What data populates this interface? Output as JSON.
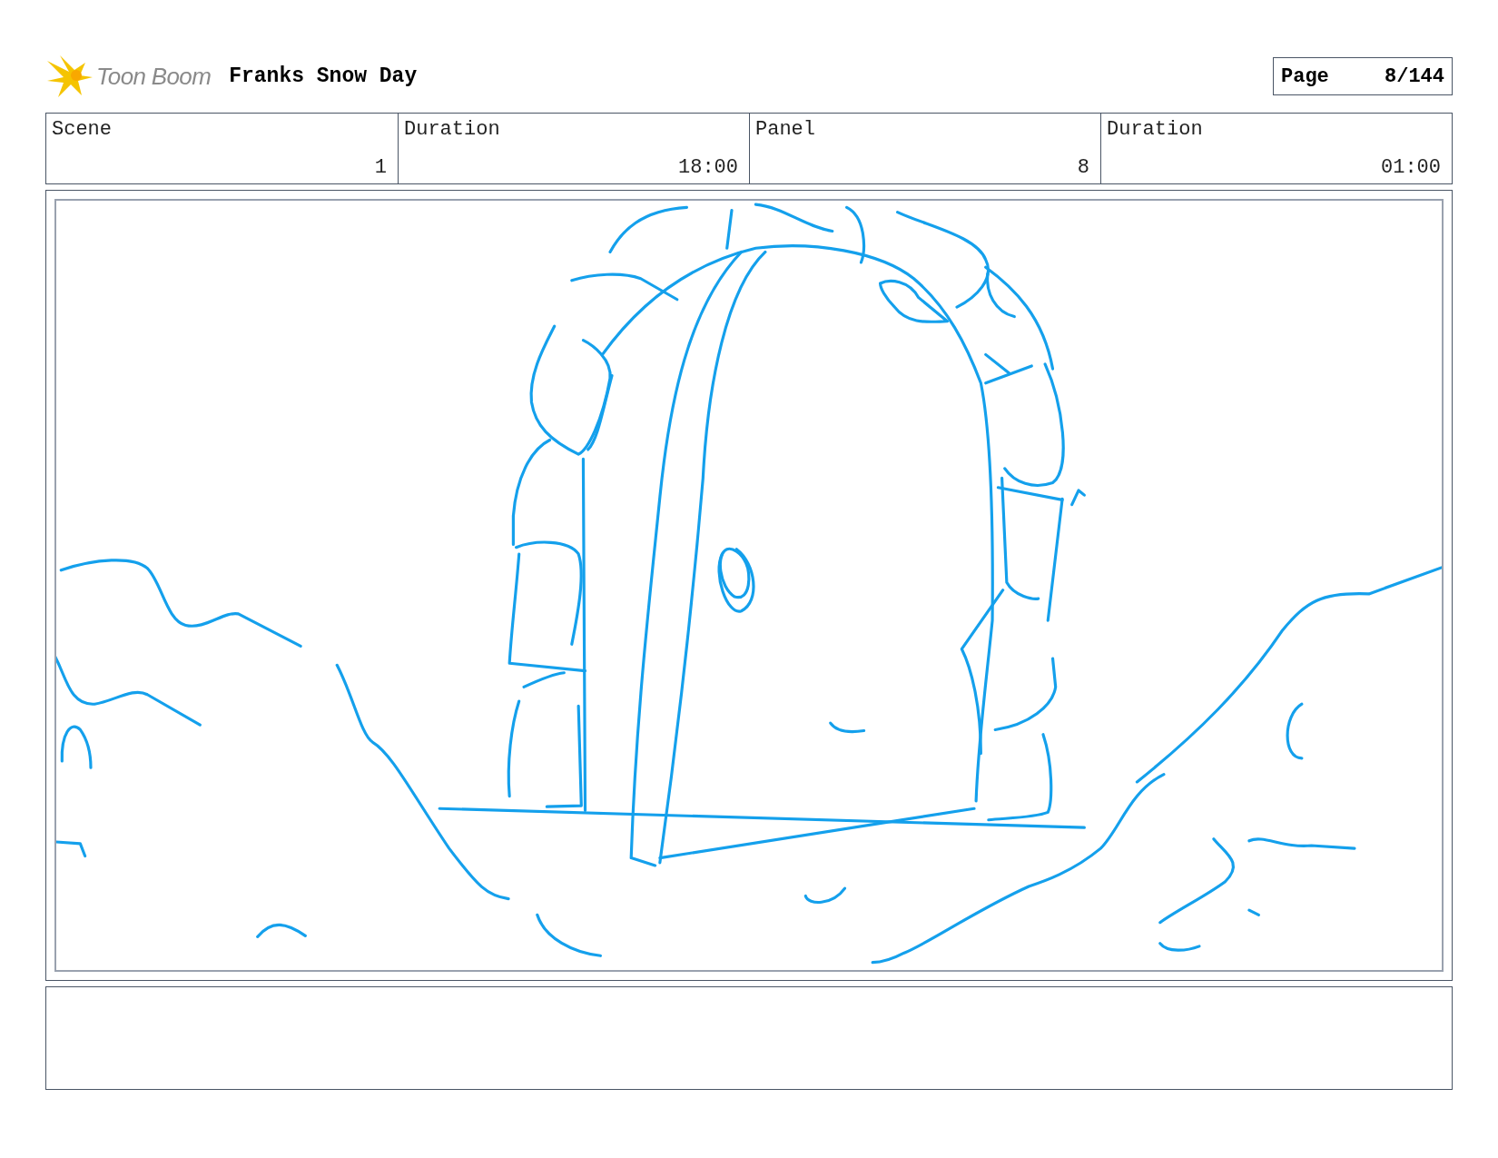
{
  "header": {
    "logo_text": "Toon Boom",
    "title": "Franks Snow Day",
    "page_label": "Page",
    "page_value": "8/144"
  },
  "info_table": {
    "columns": [
      "Scene",
      "Duration",
      "Panel",
      "Duration"
    ],
    "values": [
      "1",
      "18:00",
      "8",
      "01:00"
    ]
  }
}
